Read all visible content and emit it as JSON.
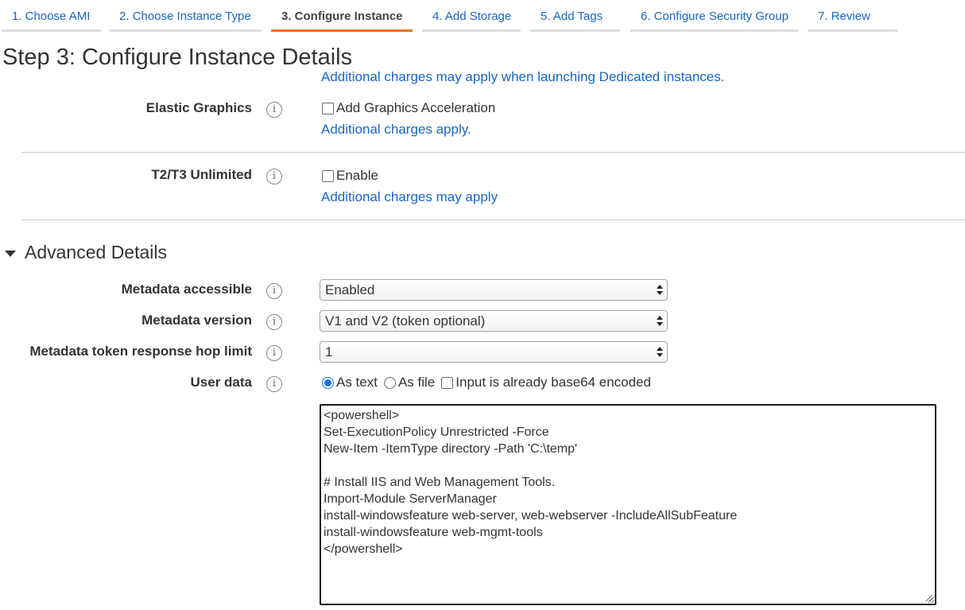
{
  "wizard": {
    "tabs": [
      {
        "label": "1. Choose AMI"
      },
      {
        "label": "2. Choose Instance Type"
      },
      {
        "label": "3. Configure Instance"
      },
      {
        "label": "4. Add Storage"
      },
      {
        "label": "5. Add Tags"
      },
      {
        "label": "6. Configure Security Group"
      },
      {
        "label": "7. Review"
      }
    ],
    "active_index": 2
  },
  "page_title": "Step 3: Configure Instance Details",
  "tenancy_note": "Additional charges may apply when launching Dedicated instances.",
  "elastic_graphics": {
    "label": "Elastic Graphics",
    "checkbox_label": "Add Graphics Acceleration",
    "checked": false,
    "link": "Additional charges apply."
  },
  "t2t3_unlimited": {
    "label": "T2/T3 Unlimited",
    "checkbox_label": "Enable",
    "checked": false,
    "link": "Additional charges may apply"
  },
  "advanced_details": {
    "title": "Advanced Details",
    "metadata_accessible": {
      "label": "Metadata accessible",
      "value": "Enabled"
    },
    "metadata_version": {
      "label": "Metadata version",
      "value": "V1 and V2 (token optional)"
    },
    "hop_limit": {
      "label": "Metadata token response hop limit",
      "value": "1"
    },
    "user_data": {
      "label": "User data",
      "options": {
        "as_text": "As text",
        "as_file": "As file",
        "base64": "Input is already base64 encoded"
      },
      "selected": "As text",
      "base64_checked": false,
      "content": "<powershell>\nSet-ExecutionPolicy Unrestricted -Force\nNew-Item -ItemType directory -Path 'C:\\temp'\n\n# Install IIS and Web Management Tools.\nImport-Module ServerManager\ninstall-windowsfeature web-server, web-webserver -IncludeAllSubFeature\ninstall-windowsfeature web-mgmt-tools\n</powershell>"
    }
  },
  "icons": {
    "info": "info-icon",
    "caret": "caret-down-icon",
    "select_arrows": "select-arrows-icon",
    "resize": "resize-grip-icon"
  },
  "colors": {
    "link": "#1866c0",
    "active_tab_border": "#ec7211",
    "radio_selected": "#1a73e8"
  }
}
